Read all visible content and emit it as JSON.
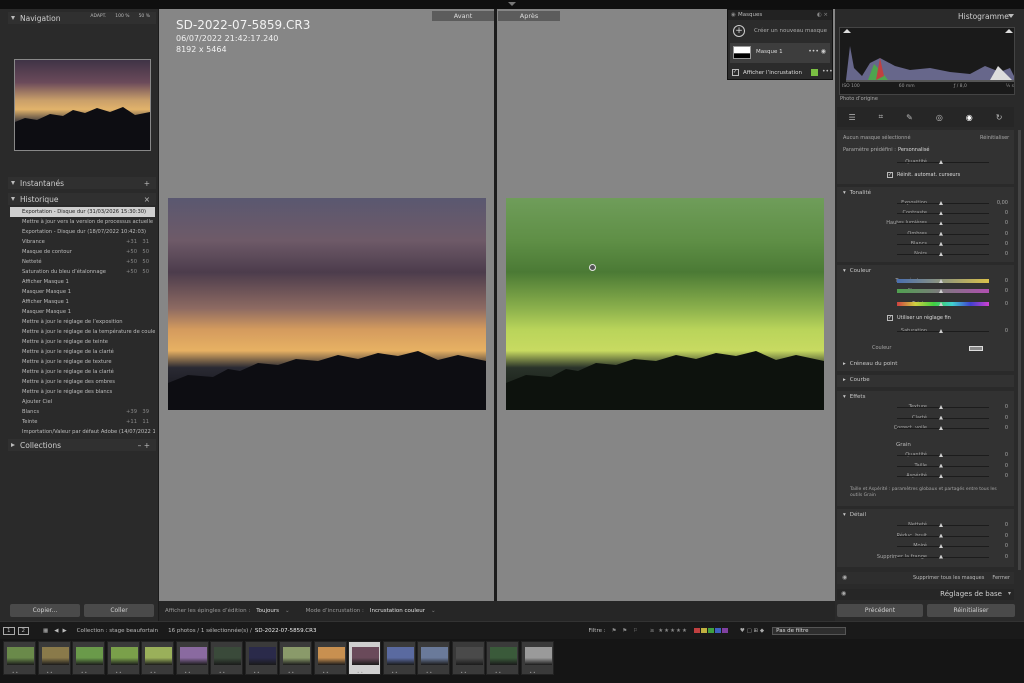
{
  "left": {
    "navigation": {
      "title": "Navigation",
      "opts": [
        "ADAPT.",
        "100 %",
        "50 %"
      ]
    },
    "instantanes": {
      "title": "Instantanés"
    },
    "historique": {
      "title": "Historique",
      "items": [
        {
          "label": "Exportation - Disque dur (31/03/2026 15:30:30)",
          "v1": "",
          "v2": ""
        },
        {
          "label": "Mettre à jour vers la version de processus actuelle",
          "v1": "",
          "v2": ""
        },
        {
          "label": "Exportation - Disque dur (18/07/2022 10:42:03)",
          "v1": "",
          "v2": ""
        },
        {
          "label": "Vibrance",
          "v1": "+31",
          "v2": "31"
        },
        {
          "label": "Masque de contour",
          "v1": "+50",
          "v2": "50"
        },
        {
          "label": "Netteté",
          "v1": "+50",
          "v2": "50"
        },
        {
          "label": "Saturation du bleu d’étalonnage",
          "v1": "+50",
          "v2": "50"
        },
        {
          "label": "Afficher Masque 1",
          "v1": "",
          "v2": ""
        },
        {
          "label": "Masquer Masque 1",
          "v1": "",
          "v2": ""
        },
        {
          "label": "Afficher Masque 1",
          "v1": "",
          "v2": ""
        },
        {
          "label": "Masquer Masque 1",
          "v1": "",
          "v2": ""
        },
        {
          "label": "Mettre à jour le réglage de l’exposition",
          "v1": "",
          "v2": ""
        },
        {
          "label": "Mettre à jour le réglage de la température de couleur",
          "v1": "",
          "v2": ""
        },
        {
          "label": "Mettre à jour le réglage de teinte",
          "v1": "",
          "v2": ""
        },
        {
          "label": "Mettre à jour le réglage de la clarté",
          "v1": "",
          "v2": ""
        },
        {
          "label": "Mettre à jour le réglage de texture",
          "v1": "",
          "v2": ""
        },
        {
          "label": "Mettre à jour le réglage de la clarté",
          "v1": "",
          "v2": ""
        },
        {
          "label": "Mettre à jour le réglage des ombres",
          "v1": "",
          "v2": ""
        },
        {
          "label": "Mettre à jour le réglage des blancs",
          "v1": "",
          "v2": ""
        },
        {
          "label": "Ajouter Ciel",
          "v1": "",
          "v2": ""
        },
        {
          "label": "Blancs",
          "v1": "+39",
          "v2": "39"
        },
        {
          "label": "Teinte",
          "v1": "+11",
          "v2": "11"
        },
        {
          "label": "Importation/Valeur par défaut Adobe (14/07/2022 15:1...",
          "v1": "",
          "v2": ""
        }
      ]
    },
    "collections": {
      "title": "Collections"
    },
    "copier": "Copier...",
    "coller": "Coller"
  },
  "center": {
    "avant": "Avant",
    "apres": "Après",
    "filename": "SD-2022-07-5859.CR3",
    "datetime": "06/07/2022 21:42:17.240",
    "dimensions": "8192 x 5464",
    "toolbar": {
      "pins_label": "Afficher les épingles d’édition :",
      "pins_value": "Toujours",
      "overlay_label": "Mode d’incrustation :",
      "overlay_value": "Incrustation couleur"
    }
  },
  "masks": {
    "title": "Masques",
    "create": "Créer un nouveau masque",
    "mask1": "Masque 1",
    "overlay": "Afficher l’incrustation"
  },
  "right": {
    "histogramme": "Histogramme",
    "exif": [
      "ISO 100",
      "60 mm",
      "ƒ / 8,0",
      "⅕ s"
    ],
    "photo_origine": "Photo d’origine",
    "selected_mask": "Aucun masque sélectionné",
    "reinitialiser": "Réinitialiser",
    "preset_label": "Paramètre prédéfini :",
    "preset_value": "Personnalisé",
    "quantite": "Quantité",
    "reinit_auto": "Réinit. automat. curseurs",
    "tonalite": {
      "title": "Tonalité",
      "sliders": [
        {
          "name": "Exposition",
          "value": "0,00"
        },
        {
          "name": "Contraste",
          "value": "0"
        },
        {
          "name": "Hautes lumières",
          "value": "0"
        },
        {
          "name": "Ombres",
          "value": "0"
        },
        {
          "name": "Blancs",
          "value": "0"
        },
        {
          "name": "Noirs",
          "value": "0"
        }
      ]
    },
    "couleur": {
      "title": "Couleur",
      "sliders": [
        {
          "name": "Température",
          "value": "0"
        },
        {
          "name": "Nuance",
          "value": "0"
        },
        {
          "name": "Teinte",
          "value": "0"
        }
      ],
      "fin": "Utiliser un réglage fin",
      "saturation": "Saturation",
      "saturation_value": "0",
      "couleur_label": "Couleur"
    },
    "creneau": "Créneau du point",
    "courbe": "Courbe",
    "effets": {
      "title": "Effets",
      "sliders": [
        {
          "name": "Texture",
          "value": "0"
        },
        {
          "name": "Clarté",
          "value": "0"
        },
        {
          "name": "Correct. voile",
          "value": "0"
        }
      ],
      "grain": "Grain",
      "grain_sliders": [
        {
          "name": "Quantité",
          "value": "0"
        },
        {
          "name": "Taille",
          "value": "0"
        },
        {
          "name": "Aspérité",
          "value": "0"
        }
      ],
      "note": "Taille et Aspérité : paramètres globaux et partagés entre tous les outils Grain"
    },
    "detail": {
      "title": "Détail",
      "sliders": [
        {
          "name": "Netteté",
          "value": "0"
        },
        {
          "name": "Réduc. bruit",
          "value": "0"
        },
        {
          "name": "Moiré",
          "value": "0"
        },
        {
          "name": "Supprimer la frange",
          "value": "0"
        }
      ]
    },
    "supprimer": "Supprimer tous les masques",
    "fermer": "Fermer",
    "reglages": "Réglages de base",
    "precedent": "Précédent",
    "reinit_btn": "Réinitialiser"
  },
  "filmstrip": {
    "pages": [
      "1",
      "2"
    ],
    "collection": "Collection : stage beaufortain",
    "count": "16 photos / 1 sélectionnée(s) /",
    "file": "SD-2022-07-5859.CR3",
    "filtre_label": "Filtre :",
    "filtre_value": "Pas de filtre"
  }
}
